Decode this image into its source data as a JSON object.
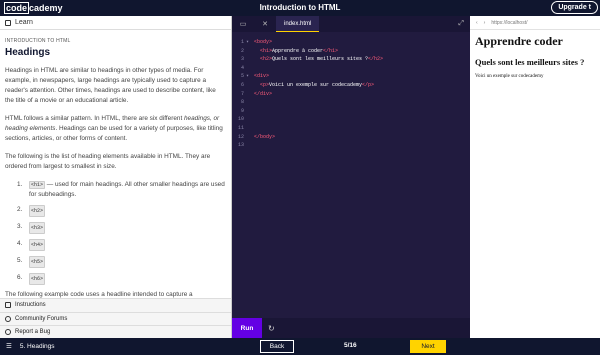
{
  "app": {
    "logo_left": "code",
    "logo_right": "cademy",
    "title": "Introduction to HTML",
    "upgrade_label": "Upgrade t"
  },
  "lesson": {
    "panel_label": "Learn",
    "eyebrow": "INTRODUCTION TO HTML",
    "heading": "Headings",
    "p1": "Headings in HTML are similar to headings in other types of media. For example, in newspapers, large headings are typically used to capture a reader's attention. Other times, headings are used to describe content, like the title of a movie or an educational article.",
    "p2_a": "HTML follows a similar pattern. In HTML, there are six different ",
    "p2_em": "headings, or heading elements",
    "p2_b": ". Headings can be used for a variety of purposes, like titling sections, articles, or other forms of content.",
    "p3": "The following is the list of heading elements available in HTML. They are ordered from largest to smallest in size.",
    "items": [
      {
        "num": "1.",
        "tag": "<h1>",
        "desc": " — used for main headings. All other smaller headings are used for subheadings."
      },
      {
        "num": "2.",
        "tag": "<h2>",
        "desc": ""
      },
      {
        "num": "3.",
        "tag": "<h3>",
        "desc": ""
      },
      {
        "num": "4.",
        "tag": "<h4>",
        "desc": ""
      },
      {
        "num": "5.",
        "tag": "<h5>",
        "desc": ""
      },
      {
        "num": "6.",
        "tag": "<h6>",
        "desc": ""
      }
    ],
    "p4": "The following example code uses a headline intended to capture a"
  },
  "links": {
    "instructions": "Instructions",
    "forums": "Community Forums",
    "bug": "Report a Bug"
  },
  "editor": {
    "tab": "index.html",
    "run": "Run",
    "lines": [
      {
        "n": "1",
        "fold": "▾",
        "pre": "",
        "tag1": "<body>",
        "text": "",
        "tag2": ""
      },
      {
        "n": "2",
        "fold": "",
        "pre": "  ",
        "tag1": "<h1>",
        "text": "Apprendre à coder",
        "tag2": "</h1>"
      },
      {
        "n": "3",
        "fold": "",
        "pre": "  ",
        "tag1": "<h2>",
        "text": "Quels sont les meilleurs sites ?",
        "tag2": "</h2>"
      },
      {
        "n": "4",
        "fold": "",
        "pre": "",
        "tag1": "",
        "text": "",
        "tag2": ""
      },
      {
        "n": "5",
        "fold": "▾",
        "pre": "",
        "tag1": "<div>",
        "text": "",
        "tag2": ""
      },
      {
        "n": "6",
        "fold": "",
        "pre": "  ",
        "tag1": "<p>",
        "text": "Voici un exemple sur codecademy",
        "tag2": "</p>"
      },
      {
        "n": "7",
        "fold": "",
        "pre": "",
        "tag1": "</div>",
        "text": "",
        "tag2": ""
      },
      {
        "n": "8",
        "fold": "",
        "pre": "",
        "tag1": "",
        "text": "",
        "tag2": ""
      },
      {
        "n": "9",
        "fold": "",
        "pre": "",
        "tag1": "",
        "text": "",
        "tag2": ""
      },
      {
        "n": "10",
        "fold": "",
        "pre": "",
        "tag1": "",
        "text": "",
        "tag2": ""
      },
      {
        "n": "11",
        "fold": "",
        "pre": "",
        "tag1": "",
        "text": "",
        "tag2": ""
      },
      {
        "n": "12",
        "fold": "",
        "pre": "",
        "tag1": "</body>",
        "text": "",
        "tag2": ""
      },
      {
        "n": "13",
        "fold": "",
        "pre": "",
        "tag1": "",
        "text": "",
        "tag2": ""
      }
    ]
  },
  "browser": {
    "url": "https://localhost/",
    "h1": "Apprendre coder",
    "h2": "Quels sont les meilleurs sites ?",
    "p": "Voici un exemple sur codecademy"
  },
  "footer": {
    "crumb": "5. Headings",
    "back": "Back",
    "progress": "5/16",
    "next": "Next"
  },
  "colors": {
    "accent": "#ffd300",
    "run": "#6400e4",
    "tag": "#ff5c7a",
    "navy": "#10162f"
  }
}
